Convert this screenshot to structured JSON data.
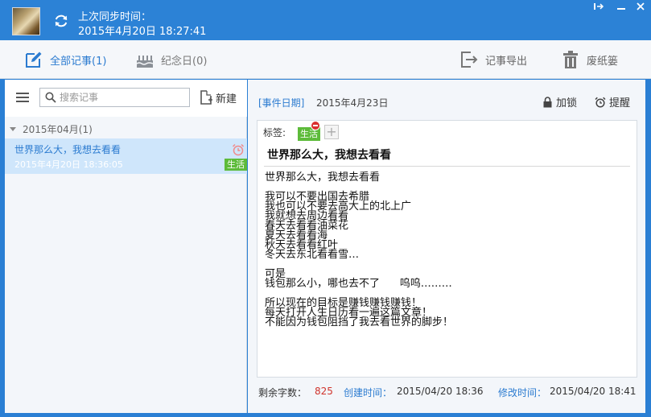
{
  "sync": {
    "label": "上次同步时间：",
    "time": "2015年4月20日 18:27:41"
  },
  "toolbar": {
    "all_notes": "全部记事(1)",
    "anniversary": "纪念日(0)",
    "export": "记事导出",
    "trash": "废纸篓"
  },
  "list": {
    "search_placeholder": "搜索记事",
    "new_label": "新建",
    "group_label": "2015年04月(1)",
    "items": [
      {
        "title": "世界那么大，我想去看看",
        "date": "2015年4月20日 18:36:05",
        "tag": "生活"
      }
    ]
  },
  "note": {
    "event_label": "[事件日期]",
    "event_date": "2015年4月23日",
    "lock_label": "加锁",
    "remind_label": "提醒",
    "tags_label": "标签:",
    "tag": "生活",
    "heading": "世界那么大，我想去看看",
    "lines": [
      "世界那么大，我想去看看",
      "",
      "我可以不要出国去希腊",
      "我也可以不要去高大上的北上广",
      "我就想去周边看看",
      "春天去看看油菜花",
      "夏天去看看海",
      "秋天去看看红叶",
      "冬天去东北看看雪…",
      "",
      "可是",
      "钱包那么小，哪也去不了      呜呜………",
      "",
      "所以现在的目标是赚钱赚钱赚钱！",
      "每天打开人生日历看一遍这篇文章！",
      "不能因为钱包阻挡了我去看世界的脚步！"
    ]
  },
  "status": {
    "remaining_label": "剩余字数：",
    "remaining_count": "825",
    "created_label": "创建时间：",
    "created_value": "2015/04/20 18:36",
    "modified_label": "修改时间：",
    "modified_value": "2015/04/20 18:41"
  },
  "colors": {
    "accent": "#2c82d6",
    "tag": "#5dbb3a",
    "selection": "#cfe6fb",
    "count": "#d0342c"
  }
}
